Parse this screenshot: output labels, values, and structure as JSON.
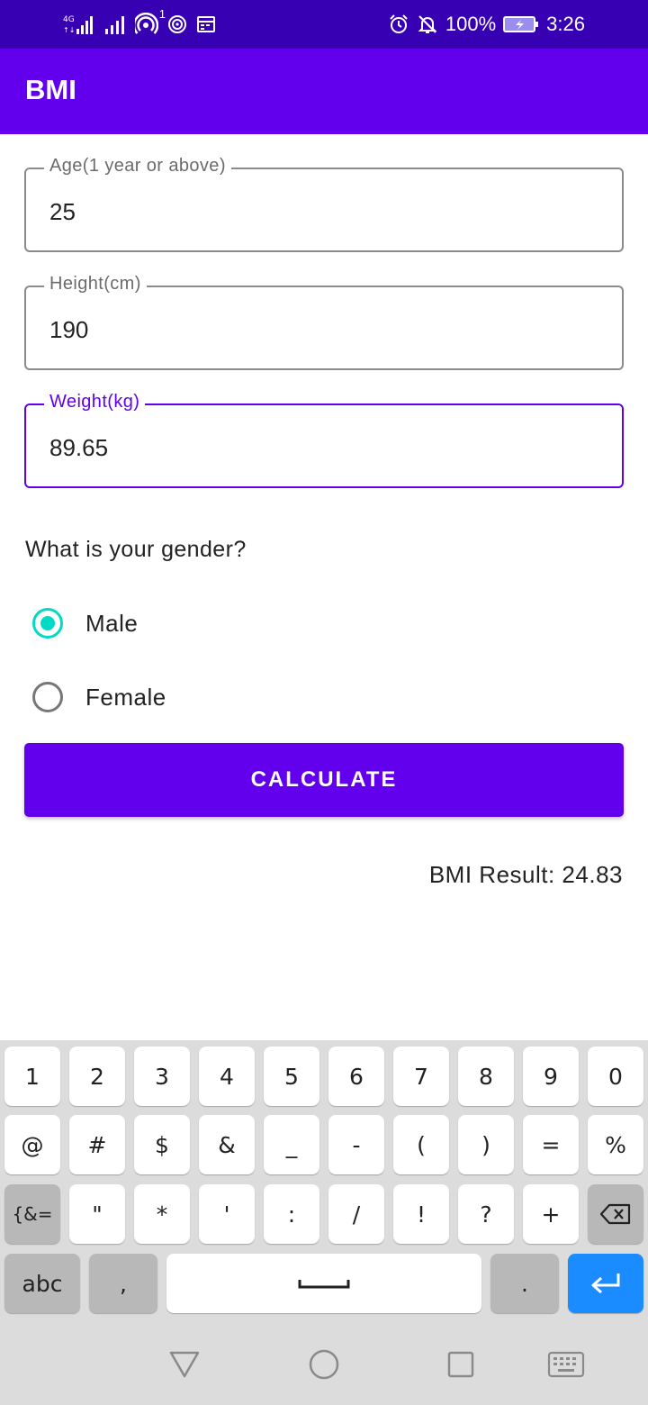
{
  "status_bar": {
    "left_icons": [
      "4g-signal-icon",
      "signal-icon",
      "hotspot-icon",
      "nfc-icon",
      "calendar-icon"
    ],
    "hotspot_badge": "1",
    "battery": "100%",
    "time": "3:26"
  },
  "appbar": {
    "title": "BMI"
  },
  "form": {
    "age": {
      "label": "Age(1 year or above)",
      "value": "25"
    },
    "height": {
      "label": "Height(cm)",
      "value": "190"
    },
    "weight": {
      "label": "Weight(kg)",
      "value": "89.65"
    },
    "gender_question": "What is your gender?",
    "gender_options": [
      {
        "label": "Male",
        "checked": true
      },
      {
        "label": "Female",
        "checked": false
      }
    ],
    "calculate_label": "CALCULATE",
    "result_text": "BMI Result: 24.83"
  },
  "keyboard": {
    "row1": [
      "1",
      "2",
      "3",
      "4",
      "5",
      "6",
      "7",
      "8",
      "9",
      "0"
    ],
    "row2": [
      "@",
      "#",
      "$",
      "&",
      "_",
      "-",
      "(",
      ")",
      "=",
      "%"
    ],
    "row3_fn": "{&=",
    "row3": [
      "\"",
      "*",
      "'",
      ":",
      "/",
      "!",
      "?",
      "+"
    ],
    "row4_abc": "abc",
    "row4_comma": ",",
    "row4_period": "."
  },
  "colors": {
    "status_bar": "#3700b3",
    "primary": "#6200ee",
    "radio_accent": "#03dac5",
    "enter_key": "#1a8cff"
  }
}
